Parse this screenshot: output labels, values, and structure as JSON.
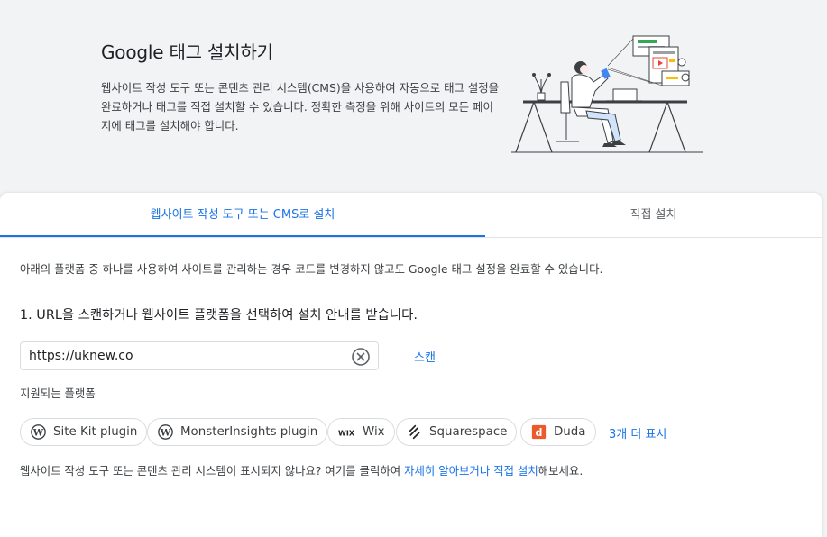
{
  "hero": {
    "title": "Google 태그 설치하기",
    "description": "웹사이트 작성 도구 또는 콘텐츠 관리 시스템(CMS)을 사용하여 자동으로 태그 설정을 완료하거나 태그를 직접 설치할 수 있습니다. 정확한 측정을 위해 사이트의 모든 페이지에 태그를 설치해야 합니다."
  },
  "tabs": [
    {
      "label": "웹사이트 작성 도구 또는 CMS로 설치",
      "active": true
    },
    {
      "label": "직접 설치",
      "active": false
    }
  ],
  "content": {
    "intro": "아래의 플랫폼 중 하나를 사용하여 사이트를 관리하는 경우 코드를 변경하지 않고도 Google 태그 설정을 완료할 수 있습니다.",
    "step1": "1. URL을 스캔하거나 웹사이트 플랫폼을 선택하여 설치 안내를 받습니다.",
    "url_value": "https://uknew.co",
    "scan_label": "스캔",
    "supported_label": "지원되는 플랫폼",
    "platforms": [
      {
        "label": "Site Kit plugin",
        "icon": "wordpress-icon"
      },
      {
        "label": "MonsterInsights plugin",
        "icon": "wordpress-icon"
      },
      {
        "label": "Wix",
        "icon": "wix-icon"
      },
      {
        "label": "Squarespace",
        "icon": "squarespace-icon"
      },
      {
        "label": "Duda",
        "icon": "duda-icon"
      }
    ],
    "more_label": "3개 더 표시",
    "footer_prefix": "웹사이트 작성 도구 또는 콘텐츠 관리 시스템이 표시되지 않나요? 여기를 클릭하여 ",
    "footer_link1": "자세히 알아보거나",
    "footer_space": " ",
    "footer_link2": "직접 설치",
    "footer_suffix": "해보세요."
  },
  "colors": {
    "accent": "#1a73e8",
    "background": "#f1f3f4",
    "duda": "#ea5a2a"
  }
}
